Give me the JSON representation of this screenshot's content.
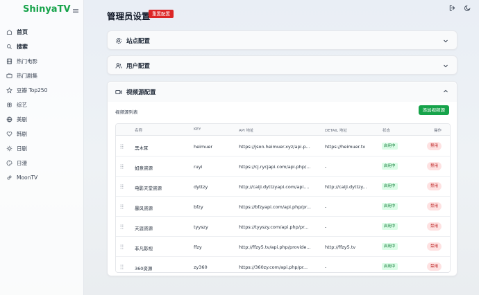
{
  "app": {
    "brand": "ShinyaTV"
  },
  "sidebar": {
    "items": [
      {
        "label": "首页",
        "icon": "home-icon",
        "bold": true
      },
      {
        "label": "搜索",
        "icon": "search-icon",
        "bold": true
      },
      {
        "label": "热门电影",
        "icon": "film-icon"
      },
      {
        "label": "热门剧集",
        "icon": "tv-icon"
      },
      {
        "label": "豆瓣 Top250",
        "icon": "star-icon"
      },
      {
        "label": "综艺",
        "icon": "clover-icon"
      },
      {
        "label": "美剧",
        "icon": "globe-icon"
      },
      {
        "label": "韩剧",
        "icon": "heart-icon"
      },
      {
        "label": "日剧",
        "icon": "sun-icon"
      },
      {
        "label": "日漫",
        "icon": "palette-icon"
      },
      {
        "label": "MoonTV",
        "icon": "link-icon"
      }
    ]
  },
  "header": {
    "title": "管理员设置",
    "reset_label": "重置配置"
  },
  "panels": {
    "site": {
      "title": "站点配置"
    },
    "users": {
      "title": "用户配置"
    },
    "video": {
      "title": "视频源配置",
      "list_title": "视频源列表",
      "add_label": "添加视频源"
    }
  },
  "table": {
    "headers": [
      "名称",
      "KEY",
      "API 地址",
      "DETAIL 地址",
      "状态",
      "操作"
    ],
    "rows": [
      {
        "name": "黑木耳",
        "key": "heimuer",
        "api": "https://json.heimuer.xyz/api.p...",
        "detail": "https://heimuer.tv",
        "status": "启用中",
        "action": "禁用"
      },
      {
        "name": "如意资源",
        "key": "ruyi",
        "api": "https://cj.rycjapi.com/api.php/...",
        "detail": "-",
        "status": "启用中",
        "action": "禁用"
      },
      {
        "name": "电影天堂资源",
        "key": "dyttzy",
        "api": "http://caiji.dyttzyapi.com/api....",
        "detail": "http://caiji.dyttzy...",
        "status": "启用中",
        "action": "禁用"
      },
      {
        "name": "暴风资源",
        "key": "bfzy",
        "api": "https://bfzyapi.com/api.php/pr...",
        "detail": "-",
        "status": "启用中",
        "action": "禁用"
      },
      {
        "name": "天涯资源",
        "key": "tyyszy",
        "api": "https://tyyszy.com/api.php/pr...",
        "detail": "-",
        "status": "启用中",
        "action": "禁用"
      },
      {
        "name": "非凡影视",
        "key": "ffzy",
        "api": "http://ffzy5.tv/api.php/provide...",
        "detail": "http://ffzy5.tv",
        "status": "启用中",
        "action": "禁用"
      },
      {
        "name": "360资源",
        "key": "zy360",
        "api": "https://360zy.com/api.php/pr...",
        "detail": "-",
        "status": "启用中",
        "action": "禁用"
      }
    ]
  },
  "colors": {
    "brand": "#16a34a",
    "danger": "#dc2626",
    "enabled_badge": "#dcfce7",
    "disable_button": "#fee2e2"
  }
}
